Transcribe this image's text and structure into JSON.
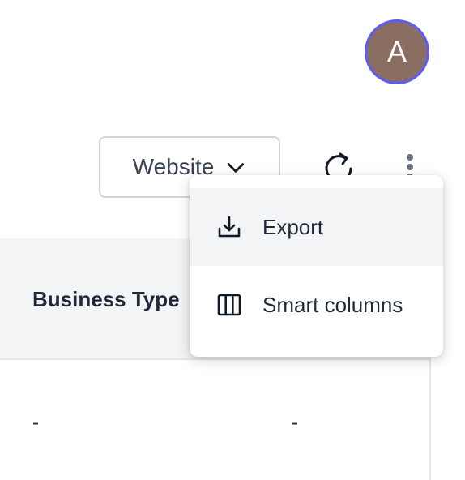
{
  "user": {
    "avatar_initial": "A"
  },
  "toolbar": {
    "website_filter_label": "Website"
  },
  "menu": {
    "items": [
      {
        "label": "Export",
        "icon": "download-icon"
      },
      {
        "label": "Smart columns",
        "icon": "columns-icon"
      }
    ]
  },
  "table": {
    "headers": [
      "Business Type"
    ],
    "rows": [
      [
        "-",
        "-"
      ]
    ]
  }
}
